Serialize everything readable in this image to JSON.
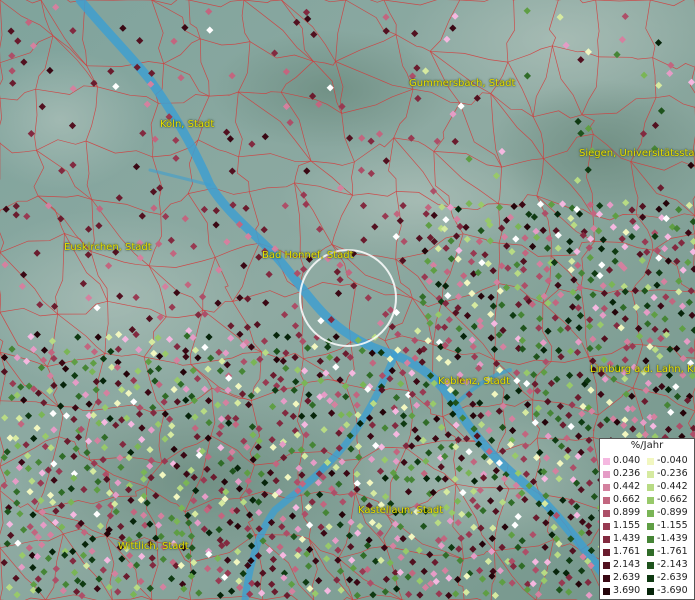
{
  "cities": [
    {
      "name": "Gummersbach, Stadt"
    },
    {
      "name": "Köln, Stadt"
    },
    {
      "name": "Siegen, Universitätsstadt"
    },
    {
      "name": "Euskirchen, Stadt"
    },
    {
      "name": "Bad Honnef, Stadt"
    },
    {
      "name": "Koblenz, Stadt"
    },
    {
      "name": "Limburg a.d. Lahn, Kreisstadt"
    },
    {
      "name": "Kastellaun, Stadt"
    },
    {
      "name": "Wittlich, Stadt"
    }
  ],
  "legend": {
    "title": "%/Jahr",
    "positive": [
      {
        "value": "0.040",
        "color": "#f5b8e0"
      },
      {
        "value": "0.236",
        "color": "#e59cc6"
      },
      {
        "value": "0.442",
        "color": "#d4819f"
      },
      {
        "value": "0.662",
        "color": "#c2667f"
      },
      {
        "value": "0.899",
        "color": "#ad4f68"
      },
      {
        "value": "1.155",
        "color": "#983a52"
      },
      {
        "value": "1.439",
        "color": "#822a40"
      },
      {
        "value": "1.761",
        "color": "#6a1c2e"
      },
      {
        "value": "2.143",
        "color": "#521120"
      },
      {
        "value": "2.639",
        "color": "#3a0814"
      },
      {
        "value": "3.690",
        "color": "#24040a"
      }
    ],
    "negative": [
      {
        "value": "-0.040",
        "color": "#f2f7c0"
      },
      {
        "value": "-0.236",
        "color": "#d6eaa0"
      },
      {
        "value": "-0.442",
        "color": "#b8db84"
      },
      {
        "value": "-0.662",
        "color": "#98c96a"
      },
      {
        "value": "-0.899",
        "color": "#7ab556"
      },
      {
        "value": "-1.155",
        "color": "#5f9e44"
      },
      {
        "value": "-1.439",
        "color": "#468536"
      },
      {
        "value": "-1.761",
        "color": "#306c28"
      },
      {
        "value": "-2.143",
        "color": "#1e531c"
      },
      {
        "value": "-2.639",
        "color": "#0f3a12"
      },
      {
        "value": "-3.690",
        "color": "#06240a"
      }
    ]
  },
  "colors": {
    "river": "#3f9fcf",
    "boundaries": "#d43a3a",
    "labels": "#e8e000",
    "marker_white": "#ffffff"
  }
}
